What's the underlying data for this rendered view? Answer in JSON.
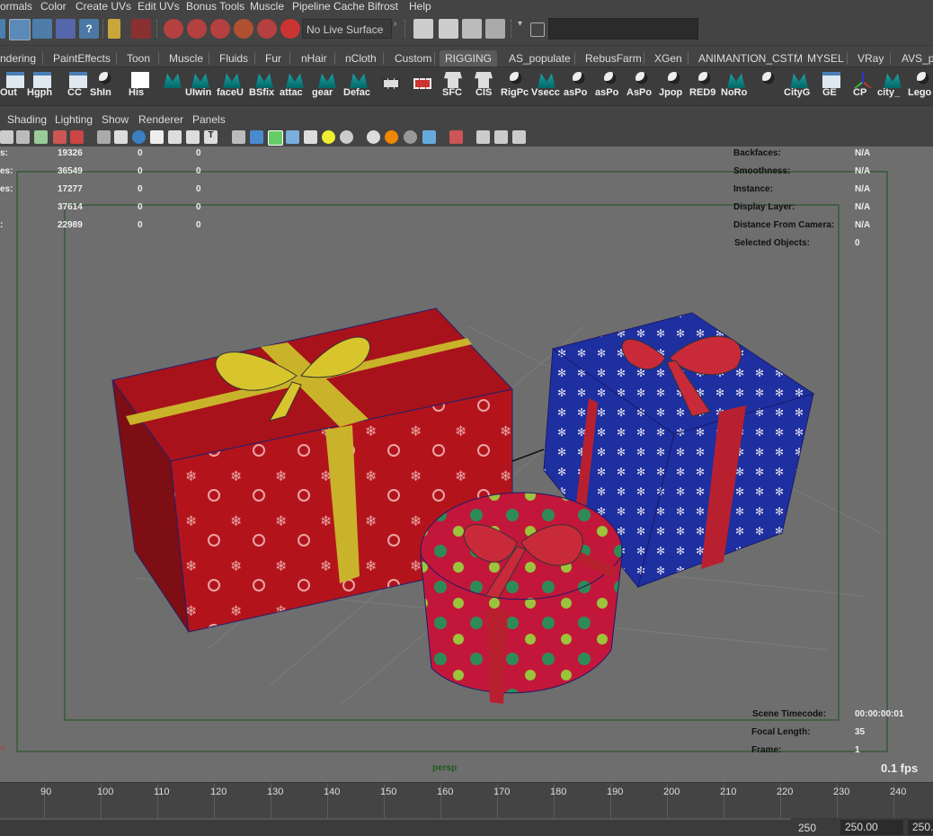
{
  "menubar": {
    "items": [
      "ormals",
      "Color",
      "Create UVs",
      "Edit UVs",
      "Bonus Tools",
      "Muscle",
      "Pipeline Cache",
      "Bifrost",
      "Help"
    ]
  },
  "statusline": {
    "live_surface": "No Live Surface"
  },
  "shelf_tabs": {
    "items": [
      "ndering",
      "PaintEffects",
      "Toon",
      "Muscle",
      "Fluids",
      "Fur",
      "nHair",
      "nCloth",
      "Custom",
      "RIGGING",
      "AS_populate",
      "RebusFarm",
      "XGen",
      "ANIMANTION_CSTM",
      "MYSEL",
      "VRay",
      "AVS_pl"
    ],
    "active": "RIGGING"
  },
  "shelf": {
    "labels": [
      "Out",
      "Hgph",
      "CC",
      "ShIn",
      "His",
      "",
      "UIwin",
      "faceU",
      "BSfix",
      "attac",
      "gear",
      "Defac",
      "",
      "",
      "SFC",
      "CIS",
      "RigPc",
      "Vsecc",
      "asPo",
      "asPo",
      "AsPo",
      "Jpop",
      "RED9",
      "NoRo",
      "",
      "CityG",
      "GE",
      "CP",
      "city_",
      "Lego"
    ]
  },
  "panel_menu": {
    "items": [
      "Shading",
      "Lighting",
      "Show",
      "Renderer",
      "Panels"
    ]
  },
  "hud": {
    "left_rows": [
      {
        "label": "s:",
        "a": "19326",
        "b": "0",
        "c": "0"
      },
      {
        "label": "es:",
        "a": "36549",
        "b": "0",
        "c": "0"
      },
      {
        "label": "es:",
        "a": "17277",
        "b": "0",
        "c": "0"
      },
      {
        "label": "",
        "a": "37614",
        "b": "0",
        "c": "0"
      },
      {
        "label": ":",
        "a": "22989",
        "b": "0",
        "c": "0"
      }
    ],
    "right_rows": [
      {
        "label": "Backfaces:",
        "value": "N/A"
      },
      {
        "label": "Smoothness:",
        "value": "N/A"
      },
      {
        "label": "Instance:",
        "value": "N/A"
      },
      {
        "label": "Display Layer:",
        "value": "N/A"
      },
      {
        "label": "Distance From Camera:",
        "value": "N/A"
      },
      {
        "label": "Selected Objects:",
        "value": "0"
      }
    ],
    "bottom_rows": [
      {
        "label": "Scene Timecode:",
        "value": "00:00:00:01"
      },
      {
        "label": "Focal Length:",
        "value": "35"
      },
      {
        "label": "Frame:",
        "value": "1"
      }
    ],
    "camera": "persp",
    "fps": "0.1 fps"
  },
  "timeline": {
    "ticks": [
      "90",
      "100",
      "110",
      "120",
      "130",
      "140",
      "150",
      "160",
      "170",
      "180",
      "190",
      "200",
      "210",
      "220",
      "230",
      "240"
    ]
  },
  "range": {
    "end_label": "250",
    "end_field": "250.00",
    "max_field": "250."
  }
}
